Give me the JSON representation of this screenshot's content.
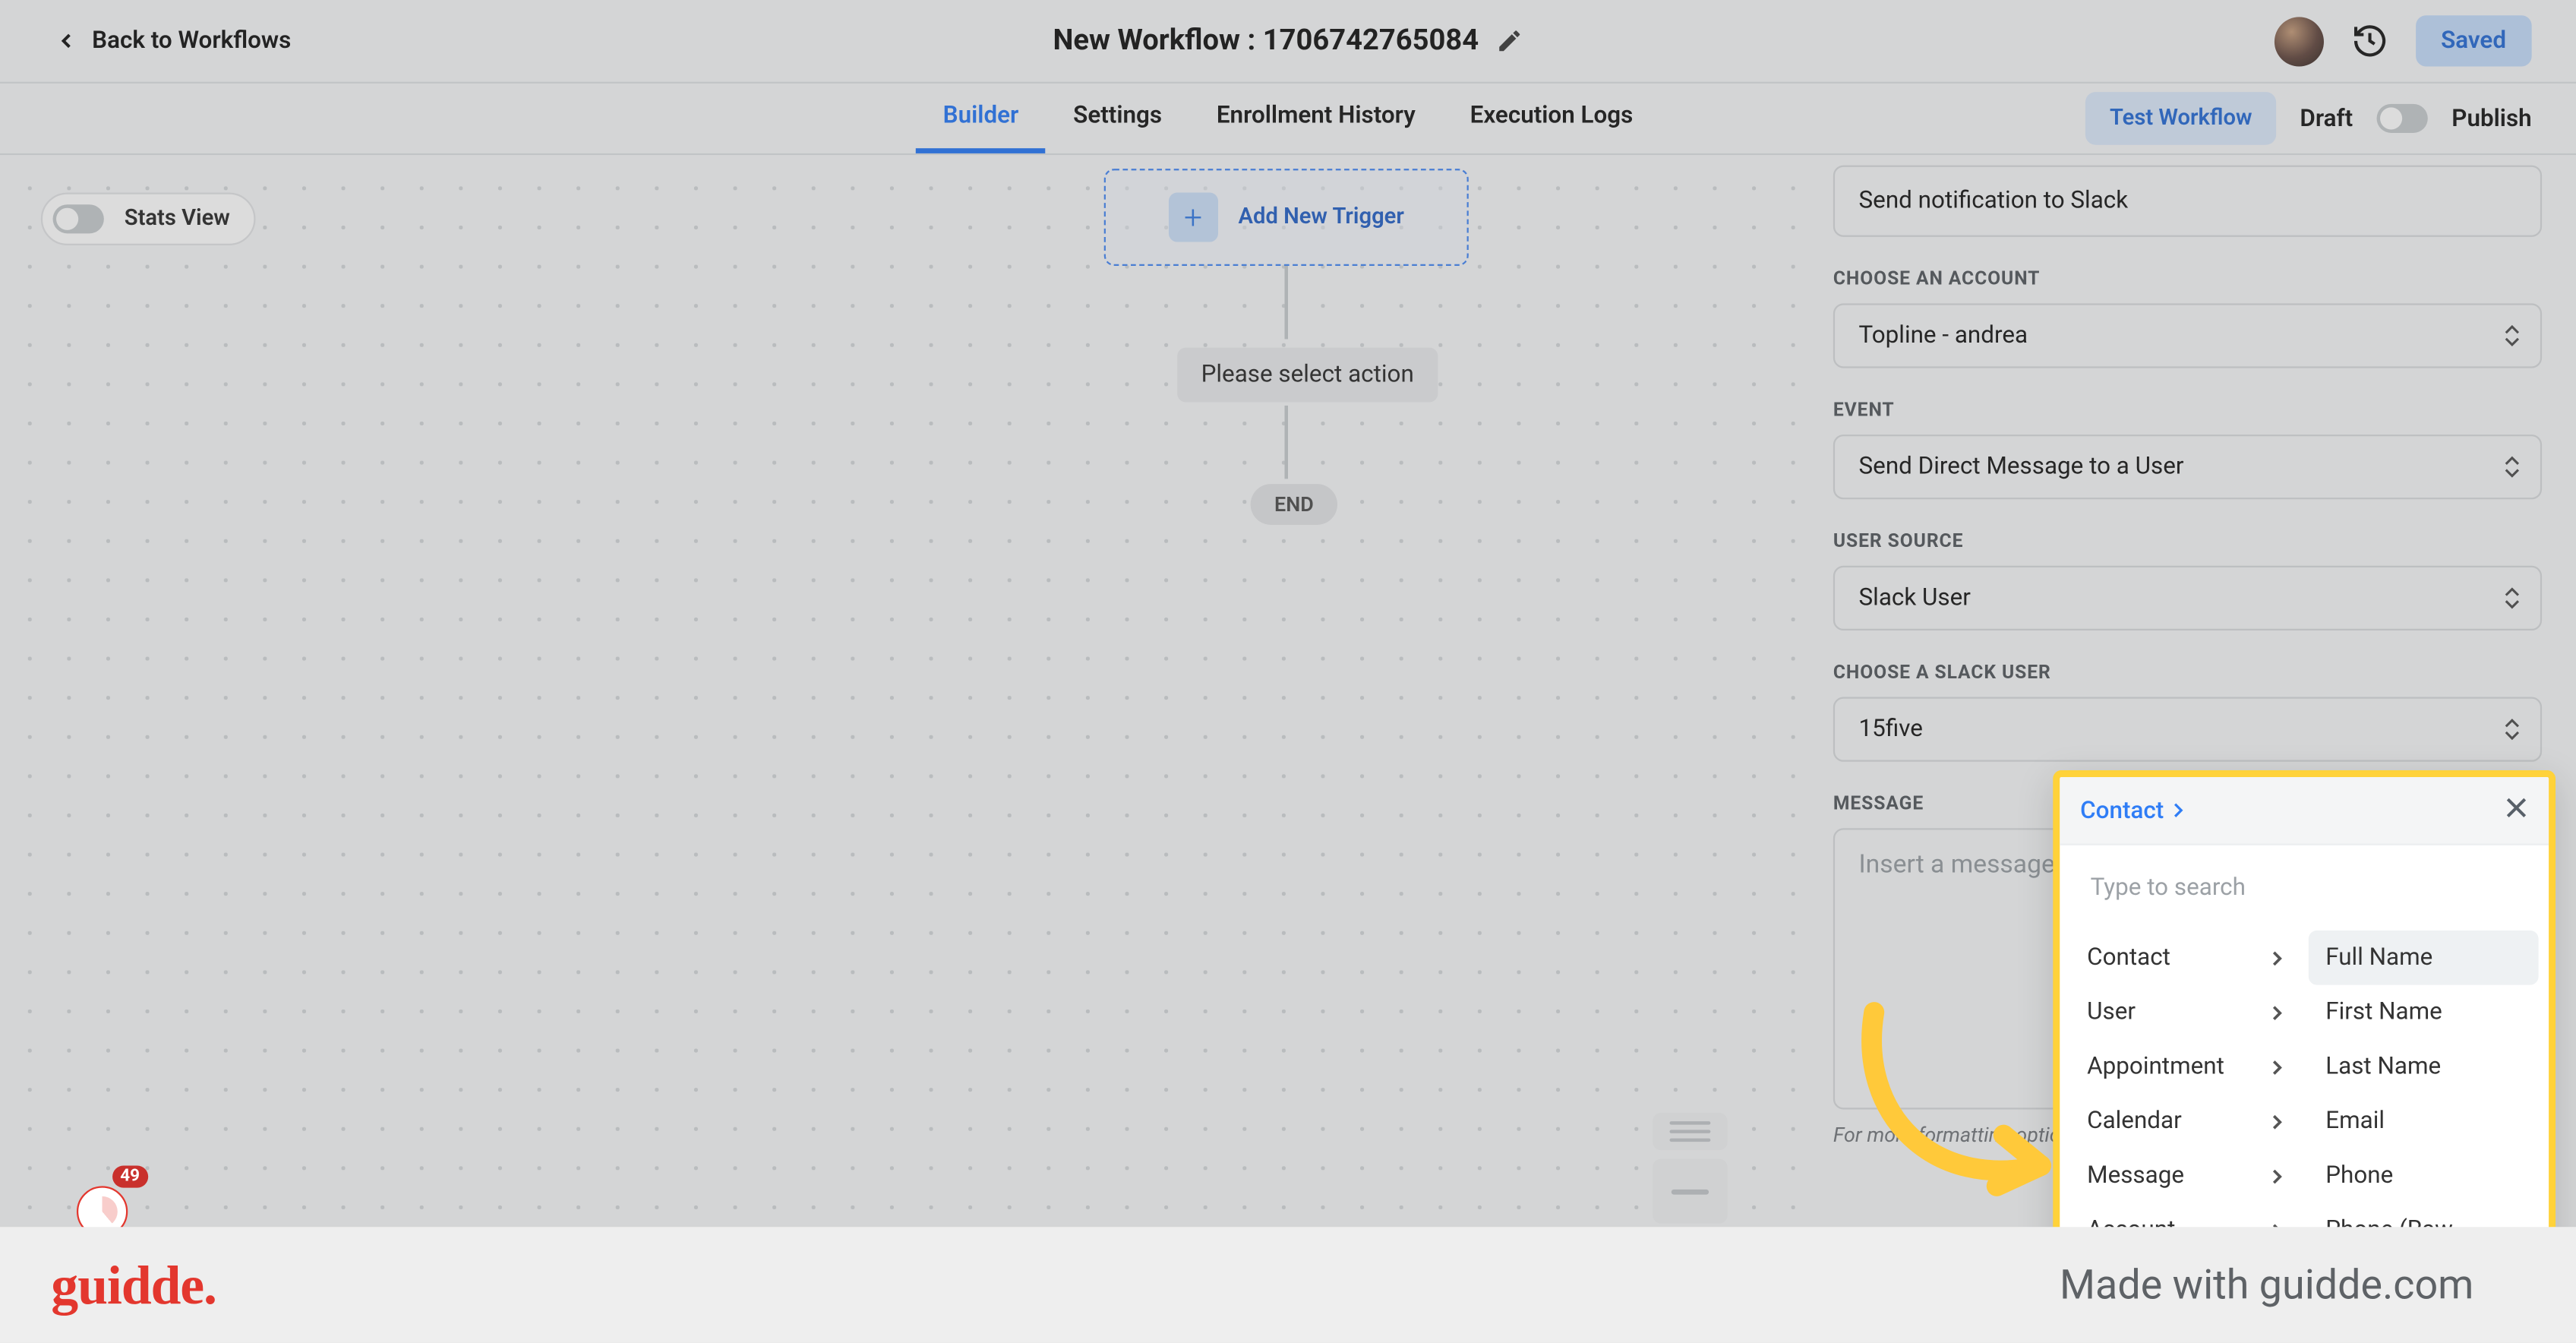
{
  "header": {
    "back_label": "Back to Workflows",
    "title": "New Workflow : 1706742765084",
    "saved_label": "Saved"
  },
  "tabs": {
    "builder": "Builder",
    "settings": "Settings",
    "enrollment": "Enrollment History",
    "execution": "Execution Logs",
    "test": "Test Workflow",
    "draft": "Draft",
    "publish": "Publish"
  },
  "canvas": {
    "stats_view": "Stats View",
    "add_trigger": "Add New Trigger",
    "select_action": "Please select action",
    "end": "END"
  },
  "panel": {
    "action_name": "Send notification to Slack",
    "labels": {
      "account": "CHOOSE AN ACCOUNT",
      "event": "EVENT",
      "user_source": "USER SOURCE",
      "slack_user": "CHOOSE A SLACK USER",
      "message": "MESSAGE"
    },
    "values": {
      "account": "Topline - andrea",
      "event": "Send Direct Message to a User",
      "user_source": "Slack User",
      "slack_user": "15five"
    },
    "message_placeholder": "Insert a message",
    "format_hint": "For more formatting options"
  },
  "popover": {
    "breadcrumb": "Contact",
    "search_placeholder": "Type to search",
    "categories": [
      "Contact",
      "User",
      "Appointment",
      "Calendar",
      "Message",
      "Account"
    ],
    "fields": [
      "Full Name",
      "First Name",
      "Last Name",
      "Email",
      "Phone",
      "Phone (Raw"
    ]
  },
  "brand": {
    "logo": "guidde.",
    "made": "Made with guidde.com",
    "badge": "49"
  }
}
